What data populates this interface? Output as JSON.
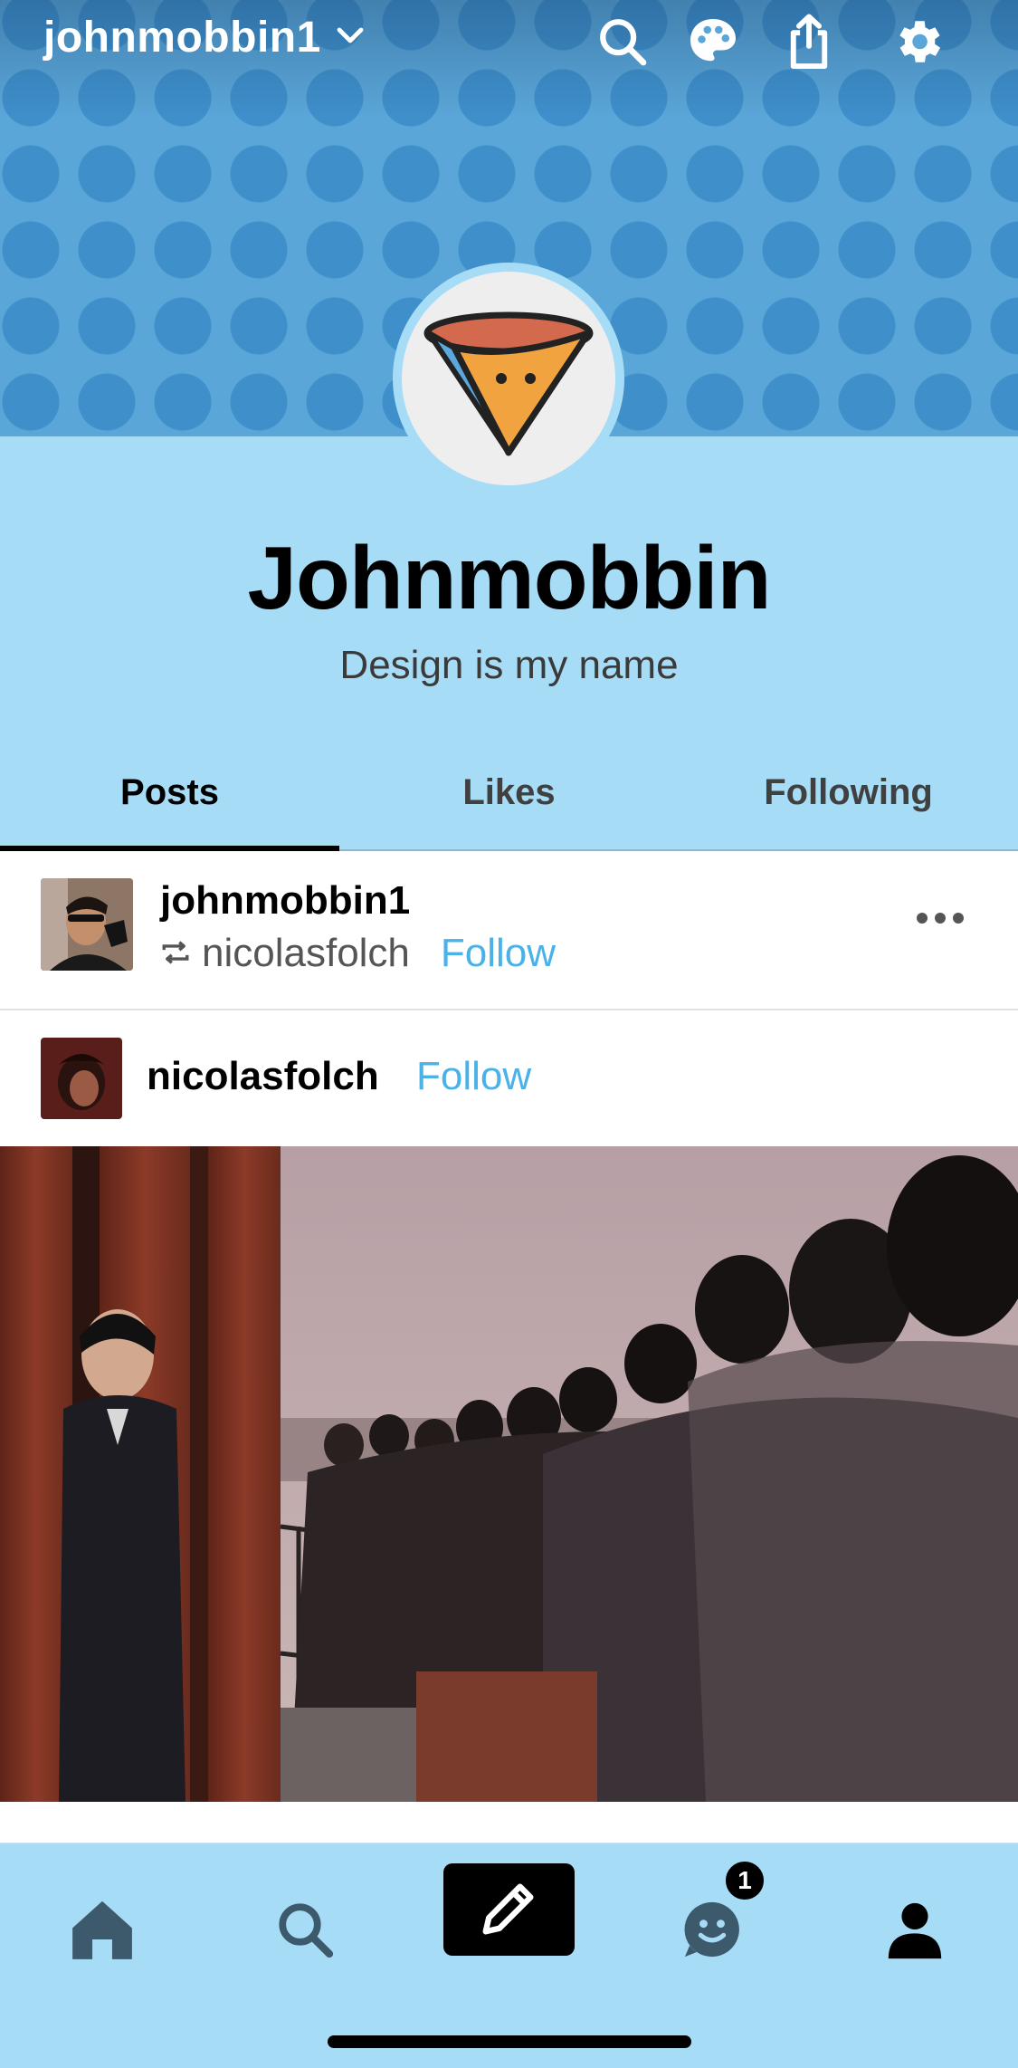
{
  "topbar": {
    "blog_name": "johnmobbin1",
    "icons": [
      "chevron-down-icon",
      "search-icon",
      "palette-icon",
      "share-icon",
      "gear-icon"
    ]
  },
  "profile": {
    "title": "Johnmobbin",
    "description": "Design is my name"
  },
  "tabs": [
    {
      "label": "Posts",
      "active": true
    },
    {
      "label": "Likes",
      "active": false
    },
    {
      "label": "Following",
      "active": false
    }
  ],
  "post": {
    "author": "johnmobbin1",
    "reblogged_from": "nicolasfolch",
    "follow_label": "Follow"
  },
  "source": {
    "name": "nicolasfolch",
    "follow_label": "Follow"
  },
  "bottom_nav": {
    "items": [
      "home-icon",
      "search-icon",
      "compose-pencil-icon",
      "activity-face-icon",
      "account-person-icon"
    ],
    "notification_count": "1"
  },
  "colors": {
    "accent_blue": "#4ab2e6",
    "profile_bg": "#a7dcf7",
    "banner_bg": "#5aa6d8"
  }
}
